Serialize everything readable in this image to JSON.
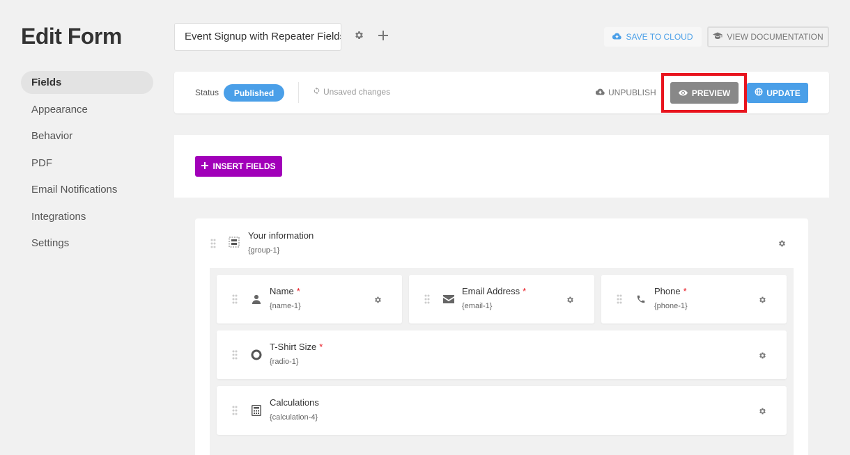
{
  "page": {
    "title": "Edit Form"
  },
  "sidebar": {
    "items": [
      {
        "label": "Fields",
        "active": true
      },
      {
        "label": "Appearance"
      },
      {
        "label": "Behavior"
      },
      {
        "label": "PDF"
      },
      {
        "label": "Email Notifications"
      },
      {
        "label": "Integrations"
      },
      {
        "label": "Settings"
      }
    ]
  },
  "header": {
    "form_title": "Event Signup with Repeater Fields",
    "save_to_cloud": "SAVE TO CLOUD",
    "view_documentation": "VIEW DOCUMENTATION"
  },
  "status": {
    "label": "Status",
    "badge": "Published",
    "unsaved": "Unsaved changes",
    "unpublish": "UNPUBLISH",
    "preview": "PREVIEW",
    "update": "UPDATE"
  },
  "builder": {
    "insert_fields": "INSERT FIELDS",
    "group": {
      "title": "Your information",
      "id": "{group-1}",
      "fields": [
        {
          "label": "Name",
          "required": "*",
          "id": "{name-1}",
          "icon": "user-icon"
        },
        {
          "label": "Email Address",
          "required": "*",
          "id": "{email-1}",
          "icon": "envelope-icon"
        },
        {
          "label": "Phone",
          "required": "*",
          "id": "{phone-1}",
          "icon": "phone-icon"
        },
        {
          "label": "T-Shirt Size",
          "required": "*",
          "id": "{radio-1}",
          "icon": "radio-icon"
        },
        {
          "label": "Calculations",
          "id": "{calculation-4}",
          "icon": "calculator-icon"
        }
      ]
    }
  },
  "colors": {
    "accent_blue": "#4a9fe8",
    "insert_purple": "#a100b9",
    "highlight_red": "#e8141e",
    "preview_gray": "#888888"
  }
}
